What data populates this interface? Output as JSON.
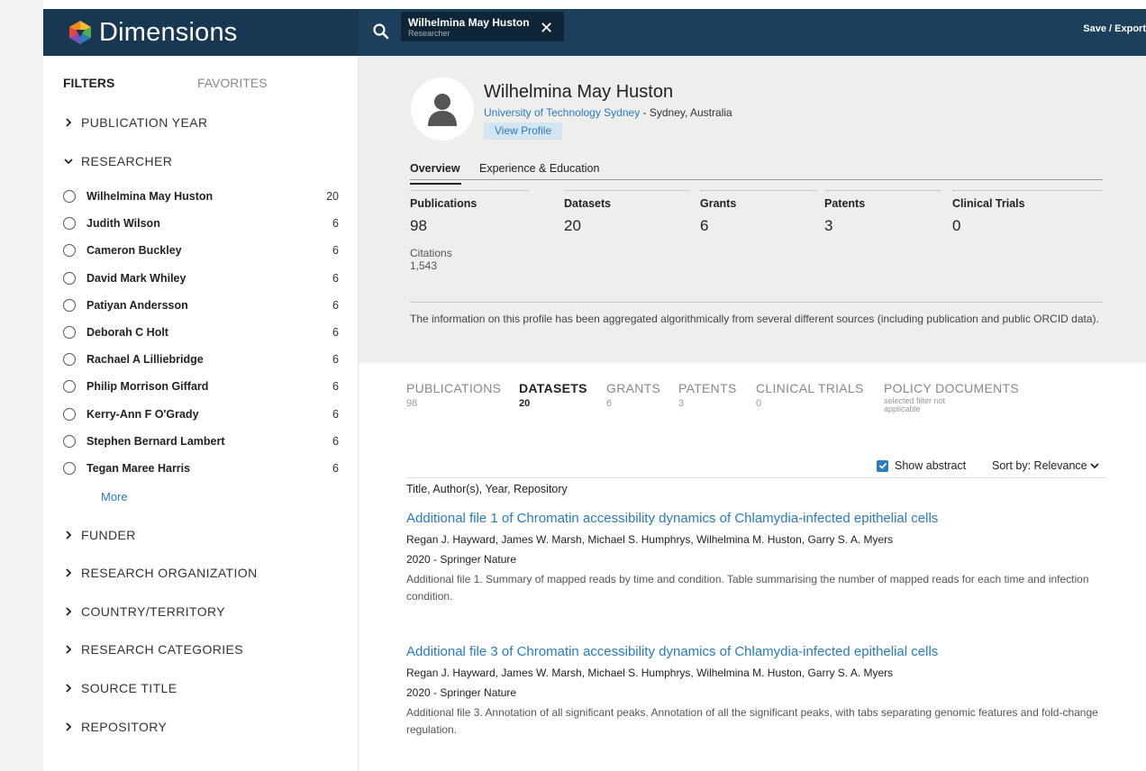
{
  "header": {
    "logo_text": "Dimensions",
    "chip": {
      "name": "Wilhelmina May Huston",
      "role": "Researcher"
    },
    "save_export": "Save / Export"
  },
  "sidebar": {
    "tabs": [
      "FILTERS",
      "FAVORITES"
    ],
    "sections": {
      "publication_year": "PUBLICATION YEAR",
      "researcher": "RESEARCHER",
      "funder": "FUNDER",
      "research_organization": "RESEARCH ORGANIZATION",
      "country": "COUNTRY/TERRITORY",
      "research_categories": "RESEARCH CATEGORIES",
      "source_title": "SOURCE TITLE",
      "repository": "REPOSITORY"
    },
    "researchers": [
      {
        "name": "Wilhelmina May Huston",
        "count": "20"
      },
      {
        "name": "Judith Wilson",
        "count": "6"
      },
      {
        "name": "Cameron Buckley",
        "count": "6"
      },
      {
        "name": "David Mark Whiley",
        "count": "6"
      },
      {
        "name": "Patiyan Andersson",
        "count": "6"
      },
      {
        "name": "Deborah C Holt",
        "count": "6"
      },
      {
        "name": "Rachael A Lilliebridge",
        "count": "6"
      },
      {
        "name": "Philip Morrison Giffard",
        "count": "6"
      },
      {
        "name": "Kerry-Ann F O'Grady",
        "count": "6"
      },
      {
        "name": "Stephen Bernard Lambert",
        "count": "6"
      },
      {
        "name": "Tegan Maree Harris",
        "count": "6"
      }
    ],
    "more_label": "More"
  },
  "profile": {
    "name": "Wilhelmina May Huston",
    "organization": "University of Technology Sydney",
    "location": " - Sydney, Australia",
    "view_profile": "View Profile",
    "tabs": [
      "Overview",
      "Experience & Education"
    ],
    "metrics": [
      {
        "label": "Publications",
        "value": "98"
      },
      {
        "label": "Datasets",
        "value": "20"
      },
      {
        "label": "Grants",
        "value": "6"
      },
      {
        "label": "Patents",
        "value": "3"
      },
      {
        "label": "Clinical Trials",
        "value": "0"
      }
    ],
    "citations_label": "Citations",
    "citations_value": "1,543",
    "note": "The information on this profile has been aggregated algorithmically from several different sources (including publication and public ORCID data)."
  },
  "results": {
    "tabs": [
      {
        "label": "PUBLICATIONS",
        "count": "98"
      },
      {
        "label": "DATASETS",
        "count": "20"
      },
      {
        "label": "GRANTS",
        "count": "6"
      },
      {
        "label": "PATENTS",
        "count": "3"
      },
      {
        "label": "CLINICAL TRIALS",
        "count": "0"
      },
      {
        "label": "POLICY DOCUMENTS",
        "note": "selected filter not applicable"
      }
    ],
    "active_tab": "DATASETS",
    "show_abstract_label": "Show abstract",
    "show_abstract_checked": true,
    "sort_label": "Sort by: Relevance",
    "column_header": "Title, Author(s), Year, Repository",
    "items": [
      {
        "title": "Additional file 1 of Chromatin accessibility dynamics of Chlamydia-infected epithelial cells",
        "authors": "Regan J. Hayward, James W. Marsh, Michael S. Humphrys, Wilhelmina M. Huston, Garry S. A. Myers",
        "meta": "2020 - Springer Nature",
        "abstract": "Additional file 1. Summary of mapped reads by time and condition. Table summarising the number of mapped reads for each time and infection condition."
      },
      {
        "title": "Additional file 3 of Chromatin accessibility dynamics of Chlamydia-infected epithelial cells",
        "authors": "Regan J. Hayward, James W. Marsh, Michael S. Humphrys, Wilhelmina M. Huston, Garry S. A. Myers",
        "meta": "2020 - Springer Nature",
        "abstract": "Additional file 3. Annotation of all significant peaks. Annotation of all the significant peaks, with tabs separating genomic features and fold-change regulation."
      }
    ]
  },
  "colors": {
    "header_bg": "#1c3f5c",
    "logo_bg": "#173753",
    "link": "#2a7bbf",
    "profile_bg": "#eeeeed"
  },
  "icons": {
    "logo": "dimensions-logo-icon",
    "search": "search-icon",
    "close": "close-icon",
    "collapsed": "chevron-right-icon",
    "expanded": "chevron-down-icon",
    "avatar": "person-icon"
  }
}
